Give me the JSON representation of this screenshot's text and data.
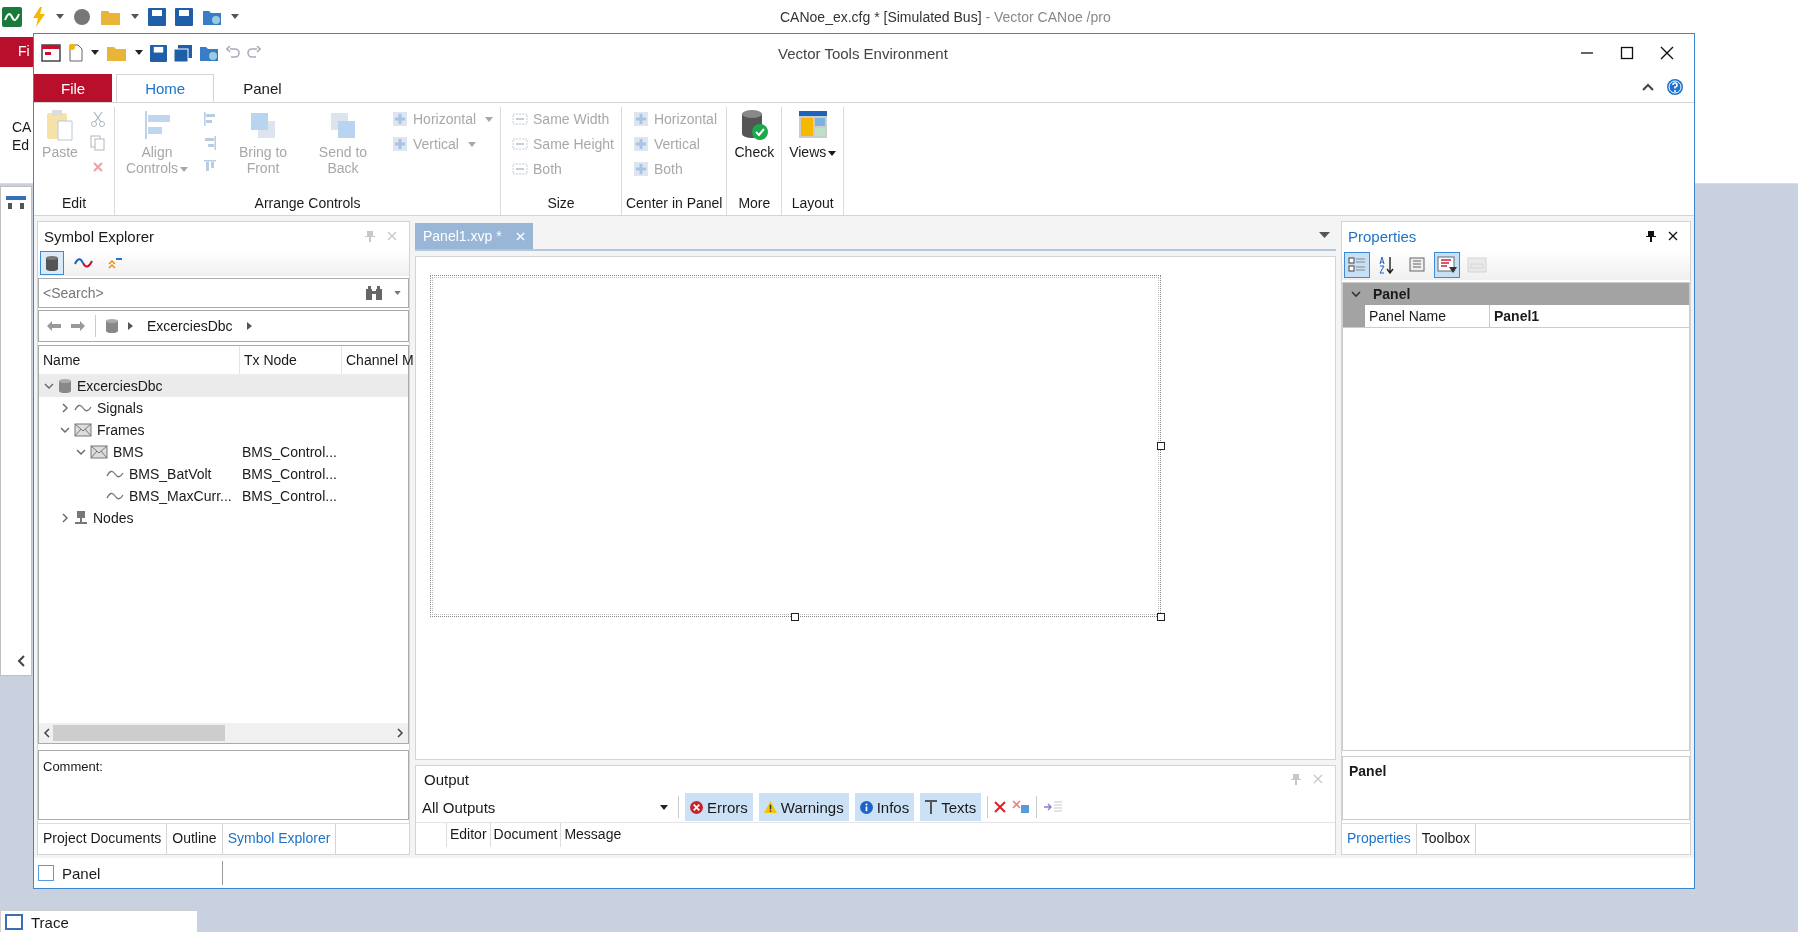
{
  "back_app": {
    "title": "CANoe_ex.cfg * [Simulated Bus]",
    "subtitle": "- Vector CANoe /pro",
    "file_tab": "Fi",
    "side_text": [
      "CA",
      "Ed"
    ],
    "trace_title": "Trace"
  },
  "dialog": {
    "title": "Vector Tools Environment"
  },
  "ribbon_tabs": [
    {
      "label": "File",
      "kind": "file",
      "selected": false
    },
    {
      "label": "Home",
      "kind": "tab",
      "selected": true
    },
    {
      "label": "Panel",
      "kind": "tab",
      "selected": false
    }
  ],
  "ribbon": {
    "groups": [
      {
        "label": "Edit",
        "buttons": [
          {
            "label": "Paste",
            "kind": "large",
            "disabled": true,
            "dropdown": false
          }
        ]
      },
      {
        "label": "Arrange Controls",
        "buttons": [
          {
            "label": "Align Controls",
            "kind": "large",
            "disabled": true,
            "dropdown": true
          },
          {
            "label": "Bring to Front",
            "kind": "large",
            "disabled": true,
            "dropdown": false
          },
          {
            "label": "Send to Back",
            "kind": "large",
            "disabled": true,
            "dropdown": false
          },
          {
            "label": "Horizontal",
            "kind": "small",
            "disabled": true,
            "dropdown": true
          },
          {
            "label": "Vertical",
            "kind": "small",
            "disabled": true,
            "dropdown": true
          }
        ]
      },
      {
        "label": "Size",
        "buttons": [
          {
            "label": "Same Width",
            "kind": "small",
            "disabled": true,
            "dropdown": false
          },
          {
            "label": "Same Height",
            "kind": "small",
            "disabled": true,
            "dropdown": false
          },
          {
            "label": "Both",
            "kind": "small",
            "disabled": true,
            "dropdown": false
          }
        ]
      },
      {
        "label": "Center in Panel",
        "buttons": [
          {
            "label": "Horizontal",
            "kind": "small",
            "disabled": true,
            "dropdown": false
          },
          {
            "label": "Vertical",
            "kind": "small",
            "disabled": true,
            "dropdown": false
          },
          {
            "label": "Both",
            "kind": "small",
            "disabled": true,
            "dropdown": false
          }
        ]
      },
      {
        "label": "More",
        "buttons": [
          {
            "label": "Check",
            "kind": "large",
            "disabled": false,
            "dropdown": false
          }
        ]
      },
      {
        "label": "Layout",
        "buttons": [
          {
            "label": "Views",
            "kind": "large",
            "disabled": false,
            "dropdown": true
          }
        ]
      }
    ]
  },
  "symbol_explorer": {
    "title": "Symbol Explorer",
    "toolbar": [
      {
        "on": true
      },
      {
        "on": false
      },
      {
        "on": false
      }
    ],
    "search": {
      "placeholder": "<Search>"
    },
    "breadcrumb": [
      "ExcerciesDbc"
    ],
    "columns": [
      "Name",
      "Tx Node",
      "Channel M"
    ],
    "tree": [
      {
        "name": "ExcerciesDbc",
        "kind": "database",
        "expanded": true,
        "selected": true,
        "children": [
          {
            "name": "Signals",
            "kind": "signals",
            "expanded": false,
            "selected": false
          },
          {
            "name": "Frames",
            "kind": "frames",
            "expanded": true,
            "selected": false,
            "children": [
              {
                "name": "BMS",
                "kind": "frame",
                "expanded": true,
                "selected": false,
                "tx_node": "BMS_Control...",
                "children": [
                  {
                    "name": "BMS_BatVolt",
                    "kind": "signal",
                    "expanded": false,
                    "selected": false,
                    "tx_node": "BMS_Control..."
                  },
                  {
                    "name": "BMS_MaxCurr...",
                    "kind": "signal",
                    "expanded": false,
                    "selected": false,
                    "tx_node": "BMS_Control..."
                  }
                ]
              }
            ]
          },
          {
            "name": "Nodes",
            "kind": "nodes",
            "expanded": false,
            "selected": false
          }
        ]
      }
    ],
    "comment": {
      "label": "Comment:"
    },
    "tabs": [
      {
        "label": "Project Documents",
        "selected": false
      },
      {
        "label": "Outline",
        "selected": false
      },
      {
        "label": "Symbol Explorer",
        "selected": true
      }
    ]
  },
  "document_tabs": [
    {
      "label": "Panel1.xvp *",
      "selected": true
    }
  ],
  "output": {
    "title": "Output",
    "filter": "All Outputs",
    "toggles": [
      {
        "label": "Errors",
        "kind": "error",
        "on": true
      },
      {
        "label": "Warnings",
        "kind": "warning",
        "on": true
      },
      {
        "label": "Infos",
        "kind": "info",
        "on": true
      },
      {
        "label": "Texts",
        "kind": "text",
        "on": true
      }
    ],
    "columns": [
      "Editor",
      "Document",
      "Message"
    ]
  },
  "properties": {
    "title": "Properties",
    "toolbar": [
      {
        "on": true,
        "disabled": false
      },
      {
        "on": false,
        "disabled": false
      },
      {
        "on": false,
        "disabled": false
      },
      {
        "on": true,
        "disabled": false
      },
      {
        "on": false,
        "disabled": true
      }
    ],
    "category": {
      "name": "Panel",
      "expanded": true
    },
    "rows": [
      {
        "name": "Panel Name",
        "value": "Panel1"
      }
    ],
    "description": "Panel",
    "tabs": [
      {
        "label": "Properties",
        "selected": true
      },
      {
        "label": "Toolbox",
        "selected": false
      }
    ]
  },
  "status_bar": {
    "checkbox": {
      "label": "Panel",
      "checked": false
    }
  }
}
